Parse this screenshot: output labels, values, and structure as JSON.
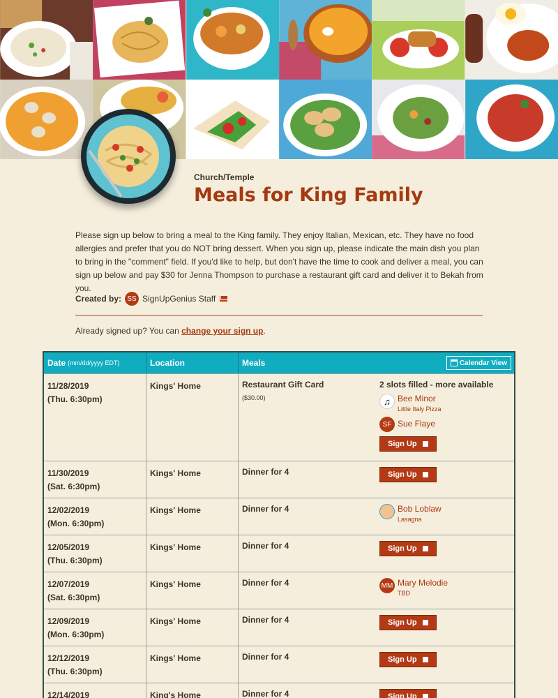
{
  "page": {
    "category": "Church/Temple",
    "title": "Meals for King Family",
    "description": "Please sign up below to bring a meal to the King family.  They enjoy Italian, Mexican, etc.  They have no food allergies and prefer that you do NOT bring dessert. When you sign up, please indicate the main dish you plan to bring in the \"comment\" field. If you'd like to help, but don't have the time to cook and deliver a meal, you can sign up below and pay $30 for Jenna Thompson to purchase a restaurant gift card and deliver it to Bekah from you."
  },
  "creator": {
    "label": "Created by:",
    "initials": "SS",
    "name": "SignUpGenius Staff"
  },
  "already": {
    "text": "Already signed up? You can ",
    "link": "change your sign up",
    "end": "."
  },
  "table": {
    "header_date": "Date",
    "header_date_note": "(mm/dd/yyyy EDT)",
    "header_location": "Location",
    "header_meals": "Meals",
    "calendar_view": "Calendar View",
    "signup_label": "Sign Up",
    "rows": [
      {
        "date": "11/28/2019",
        "time": "(Thu. 6:30pm)",
        "location": "Kings' Home",
        "meal": "Restaurant Gift Card",
        "price": "($30.00)",
        "slots_text": "2 slots filled - more available",
        "p1_initials": "♫",
        "p1_name": "Bee Minor",
        "p1_note": "Little Italy Pizza",
        "p2_initials": "SF",
        "p2_name": "Sue Flaye"
      },
      {
        "date": "11/30/2019",
        "time": "(Sat. 6:30pm)",
        "location": "Kings' Home",
        "meal": "Dinner for 4"
      },
      {
        "date": "12/02/2019",
        "time": "(Mon. 6:30pm)",
        "location": "Kings' Home",
        "meal": "Dinner for 4",
        "p_name": "Bob Loblaw",
        "p_note": "Lasagna"
      },
      {
        "date": "12/05/2019",
        "time": "(Thu. 6:30pm)",
        "location": "Kings' Home",
        "meal": "Dinner for 4"
      },
      {
        "date": "12/07/2019",
        "time": "(Sat. 6:30pm)",
        "location": "Kings' Home",
        "meal": "Dinner for 4",
        "p_initials": "MM",
        "p_name": "Mary Melodie",
        "p_note": "TBD"
      },
      {
        "date": "12/09/2019",
        "time": "(Mon. 6:30pm)",
        "location": "Kings' Home",
        "meal": "Dinner for 4"
      },
      {
        "date": "12/12/2019",
        "time": "(Thu. 6:30pm)",
        "location": "Kings' Home",
        "meal": "Dinner for 4"
      },
      {
        "date": "12/14/2019",
        "time": "",
        "location": "King's Home",
        "meal": "Dinner for 4"
      }
    ]
  },
  "colors": {
    "accent": "#a43a10",
    "header_teal": "#10adc1",
    "background": "#f6eedd",
    "button": "#b33a14"
  }
}
